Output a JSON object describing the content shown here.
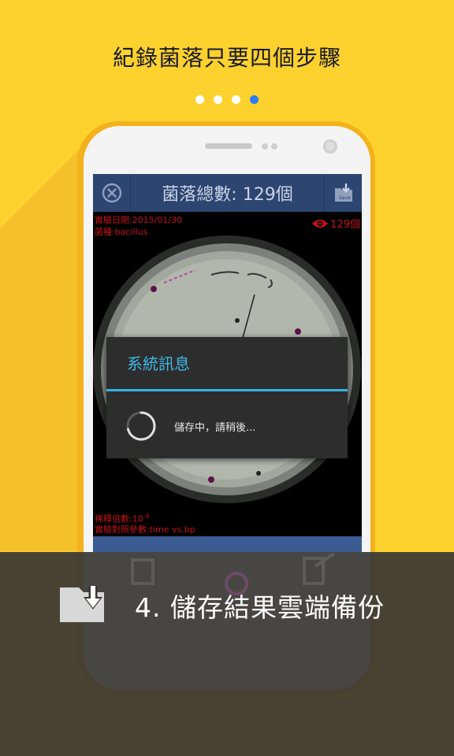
{
  "headline": "紀錄菌落只要四個步驟",
  "pager": {
    "total": 4,
    "active_index": 3
  },
  "app": {
    "topbar_title": "菌落總數: 129個",
    "save_icon_label": "Save",
    "meta_date": "實驗日期:2015/01/30",
    "meta_strain": "菌種:bacillus",
    "visible_count": "129個",
    "meta_dilution": "稀釋倍數:10",
    "meta_dilution_exp": "-6",
    "meta_params": "實驗對照參數:time vs.bp"
  },
  "dialog": {
    "title": "系統訊息",
    "message": "儲存中，請稍後..."
  },
  "step_caption": "4. 儲存結果雲端備份",
  "colors": {
    "background": "#FDD22F",
    "accent_blue": "#2E7CF6",
    "toolbar": "#2C4571",
    "dialog_title": "#3FB8E6"
  },
  "icons": [
    "close-icon",
    "save-icon",
    "eye-icon",
    "spinner-icon",
    "download-folder-icon"
  ]
}
